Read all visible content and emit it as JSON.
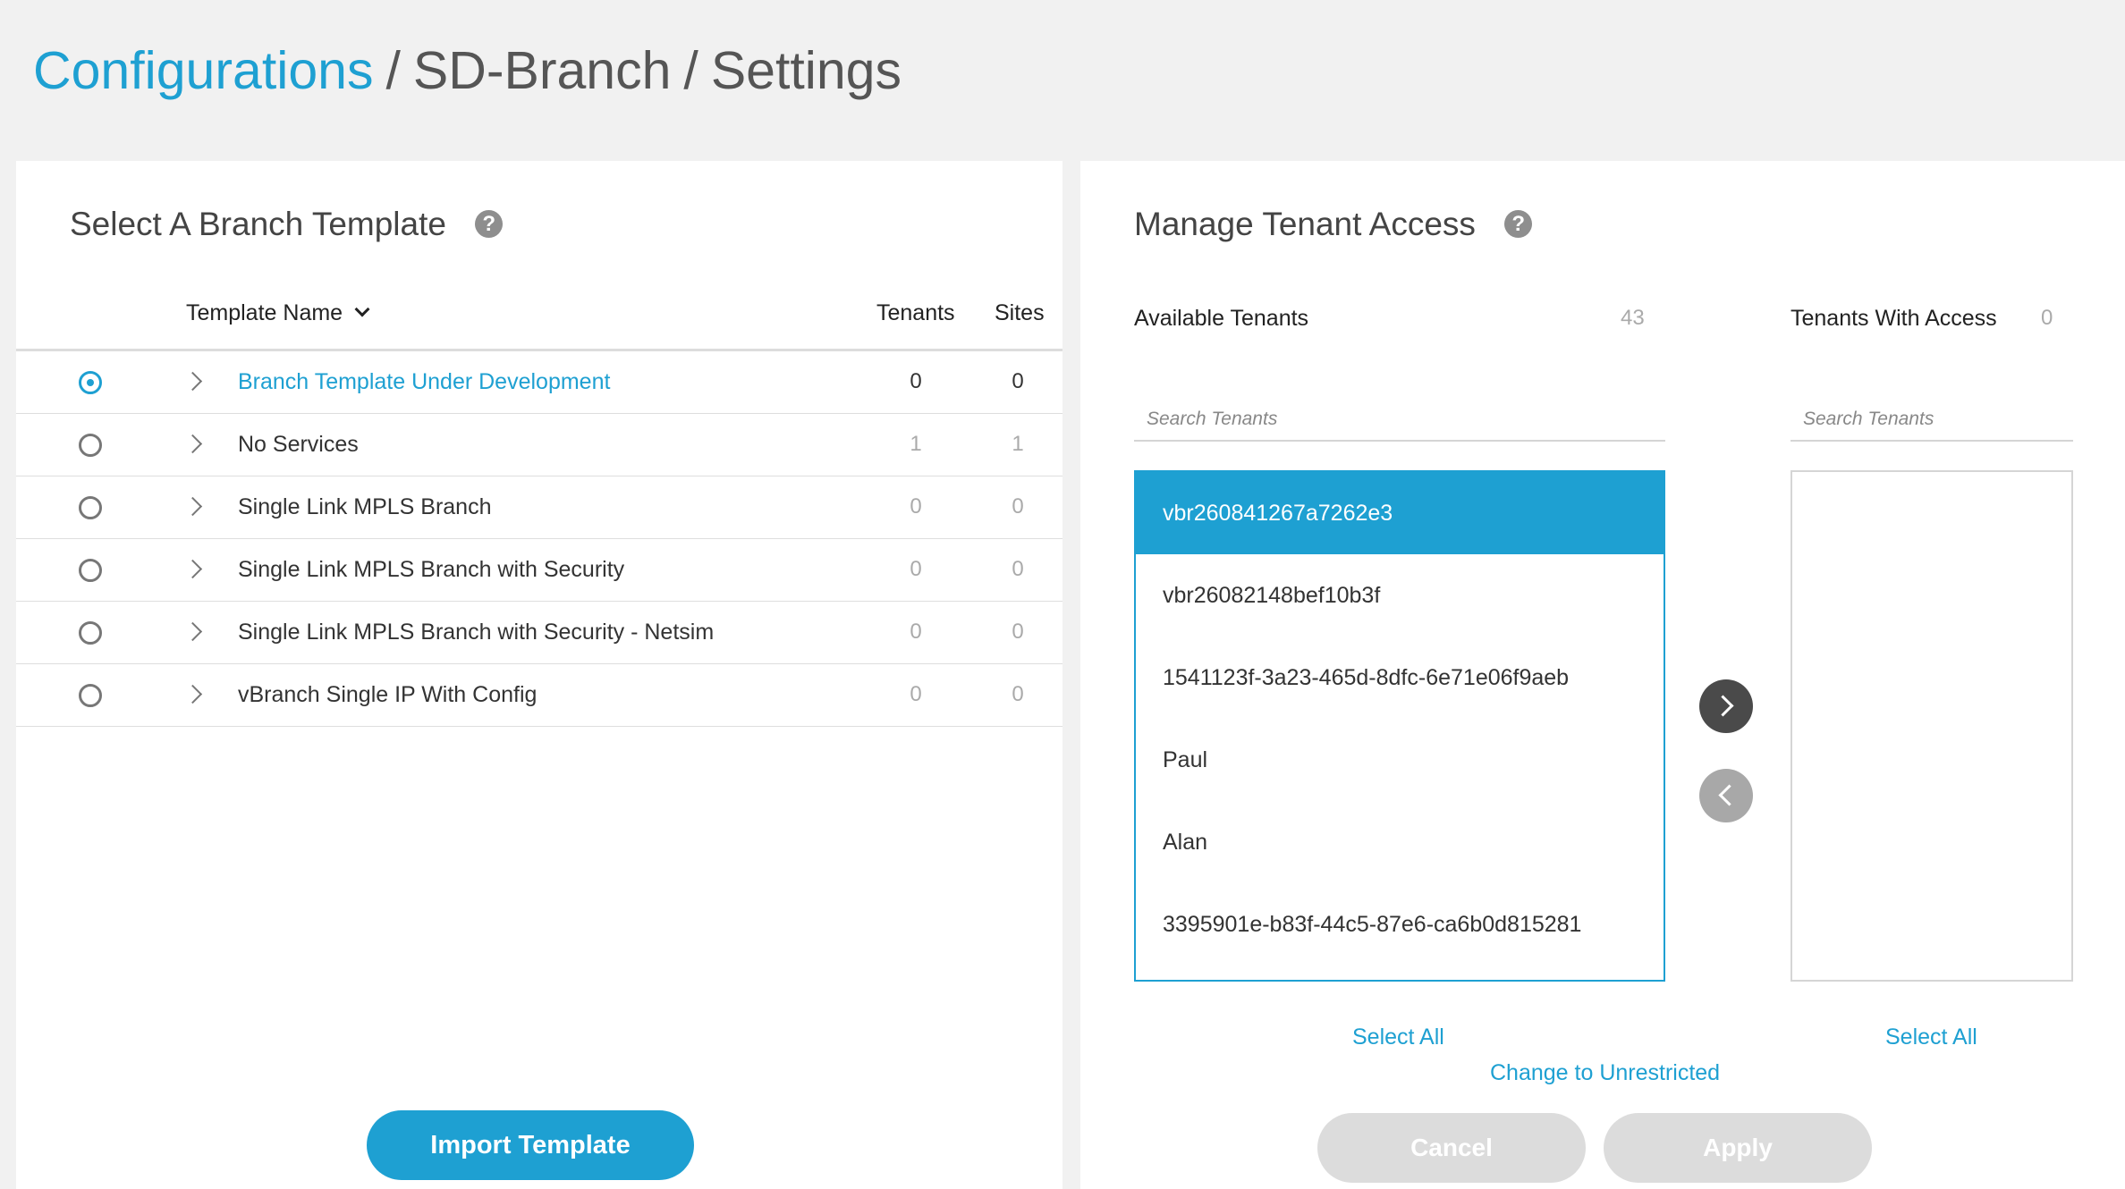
{
  "breadcrumb": {
    "root": "Configurations",
    "separator": "/",
    "middle": "SD-Branch",
    "current": "Settings"
  },
  "template_panel": {
    "title": "Select A Branch Template",
    "help_icon": "question-circle-icon",
    "columns": {
      "name": "Template Name",
      "tenants": "Tenants",
      "sites": "Sites"
    },
    "rows": [
      {
        "name": "Branch Template Under Development",
        "tenants": "0",
        "sites": "0",
        "selected": true
      },
      {
        "name": "No Services",
        "tenants": "1",
        "sites": "1",
        "selected": false
      },
      {
        "name": "Single Link MPLS Branch",
        "tenants": "0",
        "sites": "0",
        "selected": false
      },
      {
        "name": "Single Link MPLS Branch with Security",
        "tenants": "0",
        "sites": "0",
        "selected": false
      },
      {
        "name": "Single Link MPLS Branch with Security - Netsim",
        "tenants": "0",
        "sites": "0",
        "selected": false
      },
      {
        "name": "vBranch Single IP With Config",
        "tenants": "0",
        "sites": "0",
        "selected": false
      }
    ],
    "import_button": "Import Template"
  },
  "tenant_panel": {
    "title": "Manage Tenant Access",
    "available": {
      "heading": "Available Tenants",
      "count": "43",
      "search_placeholder": "Search Tenants",
      "items": [
        "vbr260841267a7262e3",
        "vbr26082148bef10b3f",
        "1541123f-3a23-465d-8dfc-6e71e06f9aeb",
        "Paul",
        "Alan",
        "3395901e-b83f-44c5-87e6-ca6b0d815281"
      ],
      "select_all": "Select All"
    },
    "with_access": {
      "heading": "Tenants With Access",
      "count": "0",
      "search_placeholder": "Search Tenants",
      "items": [],
      "select_all": "Select All"
    },
    "change_link": "Change to Unrestricted",
    "cancel_button": "Cancel",
    "apply_button": "Apply"
  },
  "colors": {
    "accent": "#1ea0d2",
    "disabled": "#dcdcdc",
    "background": "#f1f1f1"
  }
}
